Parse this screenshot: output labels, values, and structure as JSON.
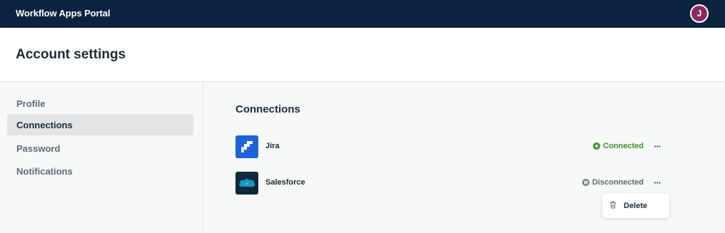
{
  "topbar": {
    "app_title": "Workflow Apps Portal",
    "avatar_initial": "J",
    "avatar_color": "#8a2a5e",
    "bg_color": "#0b2340"
  },
  "header": {
    "title": "Account settings"
  },
  "sidebar": {
    "items": [
      {
        "label": "Profile",
        "active": false
      },
      {
        "label": "Connections",
        "active": true
      },
      {
        "label": "Password",
        "active": false
      },
      {
        "label": "Notifications",
        "active": false
      }
    ]
  },
  "main": {
    "section_title": "Connections",
    "connections": [
      {
        "name": "Jira",
        "icon": "jira-logo",
        "status": "Connected",
        "status_icon": "plus-circle-icon",
        "status_color": "#3e8f2b",
        "more_label": "···"
      },
      {
        "name": "Salesforce",
        "icon": "salesforce-logo",
        "status": "Disconnected",
        "status_icon": "blocked-circle-icon",
        "status_color": "#5b6b78",
        "more_label": "···"
      }
    ],
    "menu": {
      "items": [
        {
          "label": "Delete",
          "icon": "trash-icon"
        }
      ]
    }
  }
}
